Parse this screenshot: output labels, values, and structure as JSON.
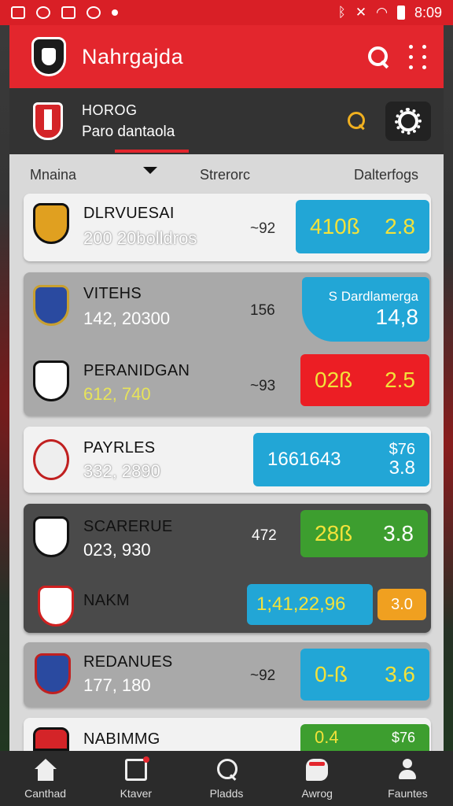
{
  "status_bar": {
    "time": "8:09"
  },
  "app": {
    "title": "Nahrgajda"
  },
  "league": {
    "title": "HOROG",
    "subtitle": "Paro dantaola"
  },
  "columns": {
    "col1": "Mnaina",
    "col2": "Strerorc",
    "col3": "Dalterfogs"
  },
  "rows": [
    {
      "name": "DLRVUESAI",
      "number": "200 20bolldros",
      "mid": "~92",
      "odds_a": "410ß",
      "odds_b": "2.8",
      "odds_color": "#22a6d6"
    },
    {
      "name": "VITEHS",
      "number": "142, 20300",
      "mid": "156",
      "odds_label": "S Dardlamerga",
      "odds_b": "14,8",
      "odds_color": "#22a6d6"
    },
    {
      "name": "PERANIDGAN",
      "number": "612, 740",
      "mid": "~93",
      "odds_a": "02ß",
      "odds_b": "2.5",
      "odds_color": "#ec1e24"
    },
    {
      "name": "PAYRLES",
      "number": "332, 2890",
      "mid": "",
      "odds_a": "1661643",
      "odds_top": "$76",
      "odds_b": "3.8",
      "odds_color": "#22a6d6"
    },
    {
      "name": "SCARERUE",
      "number": "023, 930",
      "mid": "472",
      "odds_a": "28ß",
      "odds_b": "3.8",
      "odds_color": "#3d9e2f"
    },
    {
      "name": "NAKM",
      "number": "",
      "mid": "",
      "odds_a": "1;41,22,96",
      "odds_b": "3.0",
      "odds_color": "#22a6d6"
    },
    {
      "name": "REDANUES",
      "number": "177, 180",
      "mid": "~92",
      "odds_a": "0-ß",
      "odds_b": "3.6",
      "odds_color": "#22a6d6"
    },
    {
      "name": "NABIMMG",
      "number": "",
      "mid": "",
      "odds_a": "0.4",
      "odds_top": "$76",
      "odds_b": "",
      "odds_color": "#3d9e2f"
    }
  ],
  "nav": [
    {
      "label": "Canthad",
      "icon": "home-icon"
    },
    {
      "label": "Ktaver",
      "icon": "calendar-icon"
    },
    {
      "label": "Pladds",
      "icon": "search-icon"
    },
    {
      "label": "Awrog",
      "icon": "chat-icon"
    },
    {
      "label": "Fauntes",
      "icon": "user-icon"
    }
  ]
}
